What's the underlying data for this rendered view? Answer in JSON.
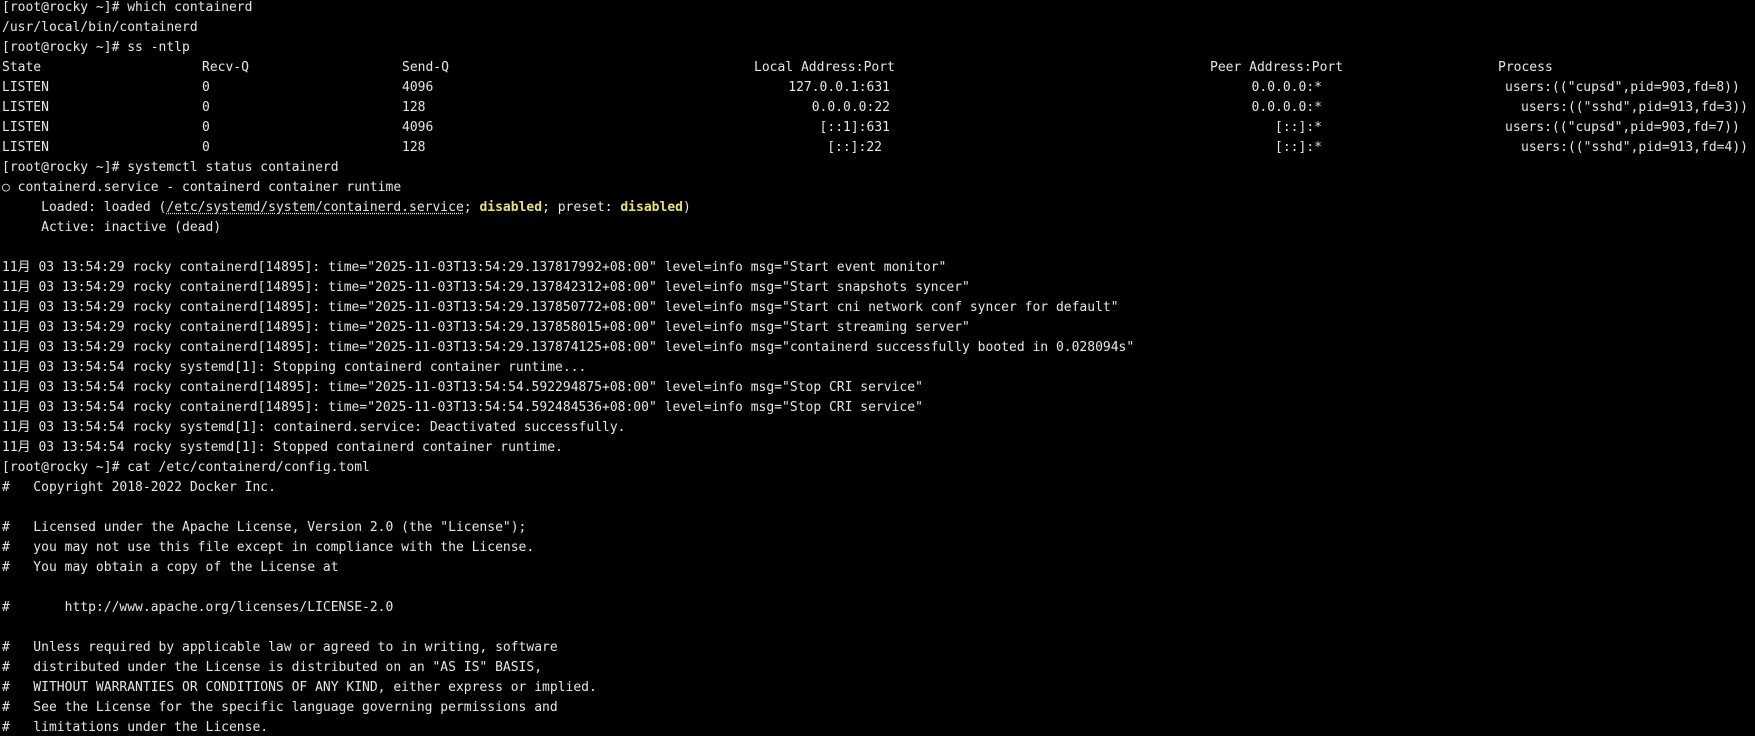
{
  "colors": {
    "background": "#000000",
    "foreground": "#e6e6e6",
    "highlight": "#e8e07a"
  },
  "lines_a": [
    "[root@rocky ~]# which containerd",
    "/usr/local/bin/containerd",
    "[root@rocky ~]# ss -ntlp"
  ],
  "ss": {
    "headers": [
      "State",
      "Recv-Q",
      "Send-Q",
      "Local Address:Port",
      "Peer Address:Port",
      "Process"
    ],
    "rows": [
      [
        "LISTEN",
        "0",
        "4096",
        "127.0.0.1:631",
        "0.0.0.0:*",
        "users:((\"cupsd\",pid=903,fd=8))"
      ],
      [
        "LISTEN",
        "0",
        "128",
        "0.0.0.0:22",
        "0.0.0.0:*",
        "users:((\"sshd\",pid=913,fd=3))"
      ],
      [
        "LISTEN",
        "0",
        "4096",
        "[::1]:631",
        "[::]:*",
        "users:((\"cupsd\",pid=903,fd=7))"
      ],
      [
        "LISTEN",
        "0",
        "128",
        "[::]:22",
        "[::]:*",
        "users:((\"sshd\",pid=913,fd=4))"
      ]
    ]
  },
  "status": {
    "prompt": "[root@rocky ~]# systemctl status containerd",
    "service": "○ containerd.service - containerd container runtime",
    "loaded_pre": "     Loaded: loaded (",
    "loaded_path": "/etc/systemd/system/containerd.service",
    "loaded_sep": "; ",
    "loaded_state": "disabled",
    "preset_label": "; preset: ",
    "preset_state": "disabled",
    "loaded_end": ")",
    "active": "     Active: inactive (dead)"
  },
  "logs": [
    "11月 03 13:54:29 rocky containerd[14895]: time=\"2025-11-03T13:54:29.137817992+08:00\" level=info msg=\"Start event monitor\"",
    "11月 03 13:54:29 rocky containerd[14895]: time=\"2025-11-03T13:54:29.137842312+08:00\" level=info msg=\"Start snapshots syncer\"",
    "11月 03 13:54:29 rocky containerd[14895]: time=\"2025-11-03T13:54:29.137850772+08:00\" level=info msg=\"Start cni network conf syncer for default\"",
    "11月 03 13:54:29 rocky containerd[14895]: time=\"2025-11-03T13:54:29.137858015+08:00\" level=info msg=\"Start streaming server\"",
    "11月 03 13:54:29 rocky containerd[14895]: time=\"2025-11-03T13:54:29.137874125+08:00\" level=info msg=\"containerd successfully booted in 0.028094s\"",
    "11月 03 13:54:54 rocky systemd[1]: Stopping containerd container runtime...",
    "11月 03 13:54:54 rocky containerd[14895]: time=\"2025-11-03T13:54:54.592294875+08:00\" level=info msg=\"Stop CRI service\"",
    "11月 03 13:54:54 rocky containerd[14895]: time=\"2025-11-03T13:54:54.592484536+08:00\" level=info msg=\"Stop CRI service\"",
    "11月 03 13:54:54 rocky systemd[1]: containerd.service: Deactivated successfully.",
    "11月 03 13:54:54 rocky systemd[1]: Stopped containerd container runtime."
  ],
  "config": [
    "[root@rocky ~]# cat /etc/containerd/config.toml",
    "#   Copyright 2018-2022 Docker Inc.",
    "",
    "#   Licensed under the Apache License, Version 2.0 (the \"License\");",
    "#   you may not use this file except in compliance with the License.",
    "#   You may obtain a copy of the License at",
    "",
    "#       http://www.apache.org/licenses/LICENSE-2.0",
    "",
    "#   Unless required by applicable law or agreed to in writing, software",
    "#   distributed under the License is distributed on an \"AS IS\" BASIS,",
    "#   WITHOUT WARRANTIES OR CONDITIONS OF ANY KIND, either express or implied.",
    "#   See the License for the specific language governing permissions and",
    "#   limitations under the License."
  ]
}
